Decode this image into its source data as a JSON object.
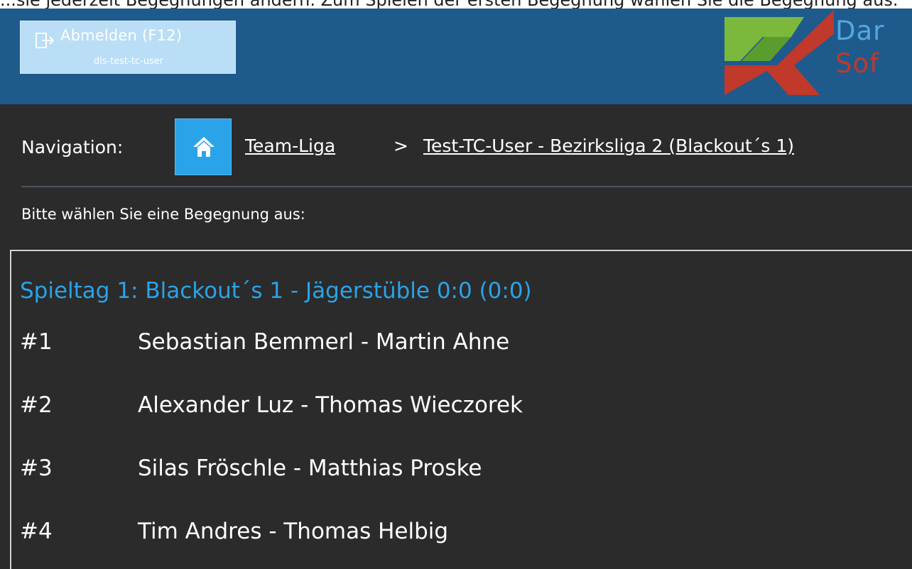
{
  "top_strip_text": "...sie jederzeit Begegnungen ändern. Zum Spielen der ersten Begegnung wählen Sie die Begegnung aus.",
  "header": {
    "logout": {
      "label": "Abmelden (F12)",
      "user": "dls-test-tc-user",
      "icon": "logout-icon"
    },
    "logo": {
      "line1": "Dar",
      "line2": "Sof"
    }
  },
  "navigation": {
    "label": "Navigation:",
    "home_icon": "home-icon",
    "crumbs": [
      {
        "label": "Team-Liga"
      },
      {
        "label": "Test-TC-User - Bezirksliga 2 (Blackout´s 1)"
      }
    ],
    "separator": ">"
  },
  "prompt": "Bitte wählen Sie eine Begegnung aus:",
  "matchday": {
    "title": "Spieltag 1: Blackout´s 1 - Jägerstüble 0:0 (0:0)",
    "matches": [
      {
        "number": "#1",
        "players": "Sebastian Bemmerl - Martin Ahne"
      },
      {
        "number": "#2",
        "players": "Alexander Luz - Thomas Wieczorek"
      },
      {
        "number": "#3",
        "players": "Silas Fröschle - Matthias Proske"
      },
      {
        "number": "#4",
        "players": "Tim Andres - Thomas Helbig"
      }
    ]
  },
  "colors": {
    "header_bg": "#1e5a8c",
    "accent": "#2aa3e8",
    "page_bg": "#2b2b2b"
  }
}
